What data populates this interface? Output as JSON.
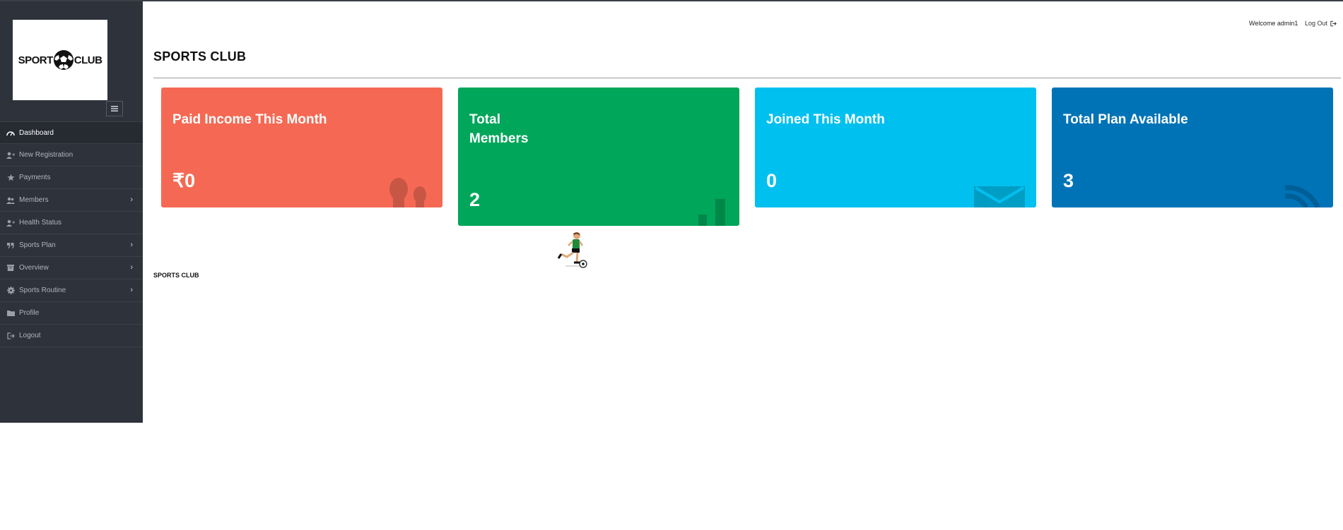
{
  "logo": {
    "word_left": "SPORT",
    "word_right": "CLUB"
  },
  "header": {
    "welcome": "Welcome admin1",
    "logout": "Log Out"
  },
  "page": {
    "title": "SPORTS CLUB",
    "footer": "SPORTS CLUB"
  },
  "sidebar": {
    "items": [
      {
        "label": "Dashboard",
        "icon": "dashboard-icon",
        "active": true
      },
      {
        "label": "New Registration",
        "icon": "user-plus-icon"
      },
      {
        "label": "Payments",
        "icon": "star-icon"
      },
      {
        "label": "Members",
        "icon": "users-icon",
        "has_submenu": true
      },
      {
        "label": "Health Status",
        "icon": "user-plus-icon"
      },
      {
        "label": "Sports Plan",
        "icon": "quote-icon",
        "has_submenu": true
      },
      {
        "label": "Overview",
        "icon": "archive-icon",
        "has_submenu": true
      },
      {
        "label": "Sports Routine",
        "icon": "gear-icon",
        "has_submenu": true
      },
      {
        "label": "Profile",
        "icon": "folder-icon"
      },
      {
        "label": "Logout",
        "icon": "sign-out-icon"
      }
    ]
  },
  "cards": [
    {
      "title": "Paid Income This Month",
      "value": "₹0",
      "color": "#f56954",
      "icon": "people-icon"
    },
    {
      "title_line1": "Total",
      "title_line2": "Members",
      "value": "2",
      "color": "#00a65a",
      "icon": "bar-chart-icon"
    },
    {
      "title": "Joined This Month",
      "value": "0",
      "color": "#00c0ef",
      "icon": "envelope-icon"
    },
    {
      "title": "Total Plan Available",
      "value": "3",
      "color": "#0073b7",
      "icon": "rss-icon"
    }
  ],
  "colors": {
    "sidebar_bg": "#2e323b",
    "sidebar_text": "#b0b5bd"
  }
}
